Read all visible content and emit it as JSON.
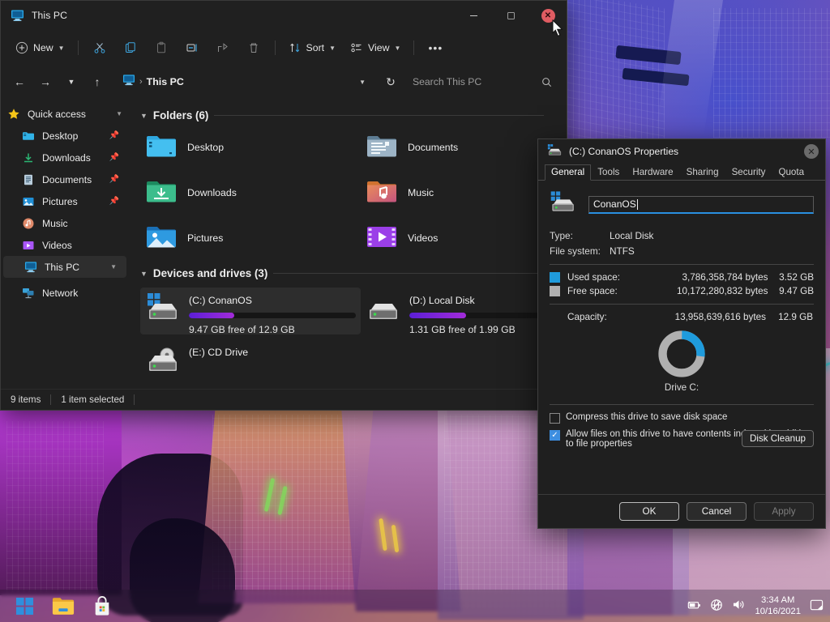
{
  "explorer": {
    "title": "This PC",
    "title_icon": "this-pc-icon",
    "window_controls": {
      "minimize": "–",
      "maximize": "❐",
      "close": "✕"
    },
    "toolbar": {
      "new_label": "New",
      "cut_icon": "scissors-icon",
      "copy_icon": "copy-icon",
      "paste_icon": "paste-icon",
      "rename_icon": "rename-icon",
      "share_icon": "share-icon",
      "delete_icon": "trash-icon",
      "sort_label": "Sort",
      "view_label": "View",
      "more_label": "•••"
    },
    "address": {
      "back_icon": "arrow-left-icon",
      "forward_icon": "arrow-right-icon",
      "recent_icon": "chevron-down-icon",
      "up_icon": "arrow-up-icon",
      "crumb_root_icon": "this-pc-icon",
      "crumb_text": "This PC",
      "crumb_sep": "›",
      "dropdown_icon": "chevron-down-icon",
      "refresh_icon": "refresh-icon",
      "search_placeholder": "Search This PC",
      "search_value": "",
      "search_icon": "search-icon"
    },
    "sidebar": {
      "groups": [
        {
          "label": "Quick access",
          "icon": "star-icon",
          "expanded": true
        },
        {
          "label": "This PC",
          "icon": "this-pc-icon",
          "selected": true
        },
        {
          "label": "Network",
          "icon": "network-icon"
        }
      ],
      "quick_access": [
        {
          "label": "Desktop",
          "icon": "desktop-folder-icon",
          "pinned": true
        },
        {
          "label": "Downloads",
          "icon": "downloads-folder-icon",
          "pinned": true
        },
        {
          "label": "Documents",
          "icon": "documents-folder-icon",
          "pinned": true
        },
        {
          "label": "Pictures",
          "icon": "pictures-folder-icon",
          "pinned": true
        },
        {
          "label": "Music",
          "icon": "music-folder-icon",
          "pinned": false
        },
        {
          "label": "Videos",
          "icon": "videos-folder-icon",
          "pinned": false
        }
      ]
    },
    "sections": {
      "folders_title": "Folders (6)",
      "drives_title": "Devices and drives (3)"
    },
    "folders": [
      {
        "label": "Desktop",
        "icon": "desktop-folder-icon"
      },
      {
        "label": "Documents",
        "icon": "documents-folder-icon"
      },
      {
        "label": "Downloads",
        "icon": "downloads-folder-icon"
      },
      {
        "label": "Music",
        "icon": "music-folder-icon"
      },
      {
        "label": "Pictures",
        "icon": "pictures-folder-icon"
      },
      {
        "label": "Videos",
        "icon": "videos-folder-icon"
      }
    ],
    "drives": [
      {
        "label": "(C:) ConanOS",
        "free_text": "9.47 GB free of 12.9 GB",
        "used_pct": 27,
        "icon": "windows-drive-icon",
        "selected": true,
        "has_bar": true
      },
      {
        "label": "(D:) Local Disk",
        "free_text": "1.31 GB free of 1.99 GB",
        "used_pct": 34,
        "icon": "hard-drive-icon",
        "selected": false,
        "has_bar": true
      },
      {
        "label": "(E:) CD Drive",
        "free_text": "",
        "used_pct": 0,
        "icon": "cd-drive-icon",
        "selected": false,
        "has_bar": false
      }
    ],
    "status": {
      "items_count": "9 items",
      "selection": "1 item selected"
    }
  },
  "properties_dialog": {
    "title": "(C:) ConanOS Properties",
    "title_icon": "hard-drive-icon",
    "close_icon": "close-icon",
    "tabs": [
      {
        "label": "General",
        "active": true
      },
      {
        "label": "Tools",
        "active": false
      },
      {
        "label": "Hardware",
        "active": false
      },
      {
        "label": "Sharing",
        "active": false
      },
      {
        "label": "Security",
        "active": false
      },
      {
        "label": "Quota",
        "active": false
      }
    ],
    "volume_icon": "windows-drive-icon",
    "volume_name_value": "ConanOS",
    "info": [
      {
        "key": "Type:",
        "value": "Local Disk"
      },
      {
        "key": "File system:",
        "value": "NTFS"
      }
    ],
    "space": [
      {
        "label": "Used space:",
        "bytes": "3,786,358,784 bytes",
        "gb": "3.52 GB",
        "color": "#1f9bdc"
      },
      {
        "label": "Free space:",
        "bytes": "10,172,280,832 bytes",
        "gb": "9.47 GB",
        "color": "#b0b0b0"
      }
    ],
    "capacity": {
      "label": "Capacity:",
      "bytes": "13,958,639,616 bytes",
      "gb": "12.9 GB"
    },
    "drive_caption": "Drive C:",
    "disk_cleanup_label": "Disk Cleanup",
    "checkboxes": [
      {
        "label": "Compress this drive to save disk space",
        "checked": false
      },
      {
        "label": "Allow files on this drive to have contents indexed in addition to file properties",
        "checked": true
      }
    ],
    "buttons": [
      {
        "label": "OK",
        "state": "primary"
      },
      {
        "label": "Cancel",
        "state": "normal"
      },
      {
        "label": "Apply",
        "state": "disabled"
      }
    ],
    "chart_data": {
      "type": "pie",
      "title": "Drive C:",
      "categories": [
        "Used space",
        "Free space"
      ],
      "values": [
        3.52,
        9.47
      ],
      "unit": "GB",
      "colors": [
        "#1f9bdc",
        "#b0b0b0"
      ],
      "legend": "left-swatches"
    }
  },
  "taskbar": {
    "apps": [
      {
        "name": "start-button",
        "icon": "windows-logo-icon"
      },
      {
        "name": "file-explorer-button",
        "icon": "folder-icon"
      },
      {
        "name": "microsoft-store-button",
        "icon": "store-icon"
      }
    ],
    "tray": {
      "battery_icon": "battery-charging-icon",
      "network_icon": "globe-no-internet-icon",
      "volume_icon": "speaker-icon",
      "time": "3:34 AM",
      "date": "10/16/2021",
      "notifications_icon": "notification-icon"
    }
  },
  "colors": {
    "accent_blue": "#1f9bdc",
    "drive_bar": "#7a27d8",
    "close_red": "#e05c62",
    "window_bg": "#202020",
    "dialog_bg": "#1f1f1f"
  }
}
